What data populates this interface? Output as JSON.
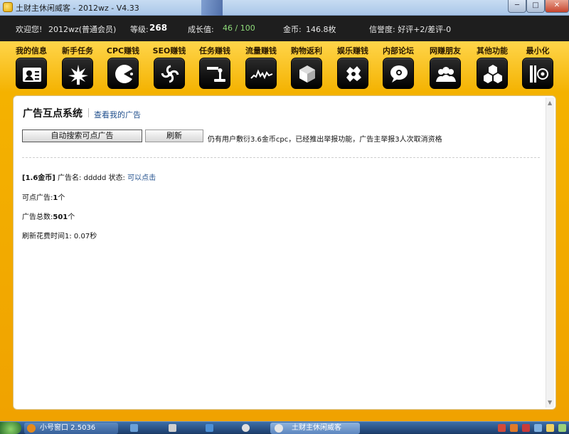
{
  "window": {
    "title": "土财主休闲威客 - 2012wz - V4.33",
    "minimize": "─",
    "maximize": "□",
    "close": "✕"
  },
  "status": {
    "welcome": "欢迎您!",
    "user": "2012wz(普通会员)",
    "level_label": "等级:",
    "level_value": "268",
    "growth_label": "成长值:",
    "growth_value": "46 / 100",
    "coins_label": "金币:",
    "coins_value": "146.8枚",
    "credit": "信誉度: 好评+2/差评-0"
  },
  "toolbar": [
    {
      "label": "我的信息",
      "icon": "id-card-icon"
    },
    {
      "label": "新手任务",
      "icon": "leaf-icon"
    },
    {
      "label": "CPC赚钱",
      "icon": "pacman-icon"
    },
    {
      "label": "SEO赚钱",
      "icon": "swirl-icon"
    },
    {
      "label": "任务赚钱",
      "icon": "joystick-icon"
    },
    {
      "label": "流量赚钱",
      "icon": "wave-icon"
    },
    {
      "label": "购物返利",
      "icon": "box-icon"
    },
    {
      "label": "娱乐赚钱",
      "icon": "game-icon"
    },
    {
      "label": "内部论坛",
      "icon": "chat-icon"
    },
    {
      "label": "网赚朋友",
      "icon": "friends-icon"
    },
    {
      "label": "其他功能",
      "icon": "cubes-icon"
    },
    {
      "label": "最小化",
      "icon": "minimize-icon"
    }
  ],
  "main": {
    "title": "广告互点系统",
    "my_ads_link": "查看我的广告",
    "search_button": "自动搜索可点广告",
    "refresh_button": "刷新",
    "notice": "仍有用户敷衍3.6金币cpc，已经推出举报功能，广告主举报3人次取消资格",
    "ad": {
      "price": "[1.6金币]",
      "name_label": "广告名:",
      "name": "ddddd",
      "status_label": "状态:",
      "status": "可以点击"
    },
    "clickable_label": "可点广告:",
    "clickable_value": "1",
    "clickable_unit": "个",
    "total_label": "广告总数:",
    "total_value": "501",
    "total_unit": "个",
    "refresh_time_label": "刷新花费时间1:",
    "refresh_time_value": "0.07秒"
  },
  "taskbar": {
    "task1": "小号窗口 2.5036",
    "task2": "土财主休闲威客"
  }
}
